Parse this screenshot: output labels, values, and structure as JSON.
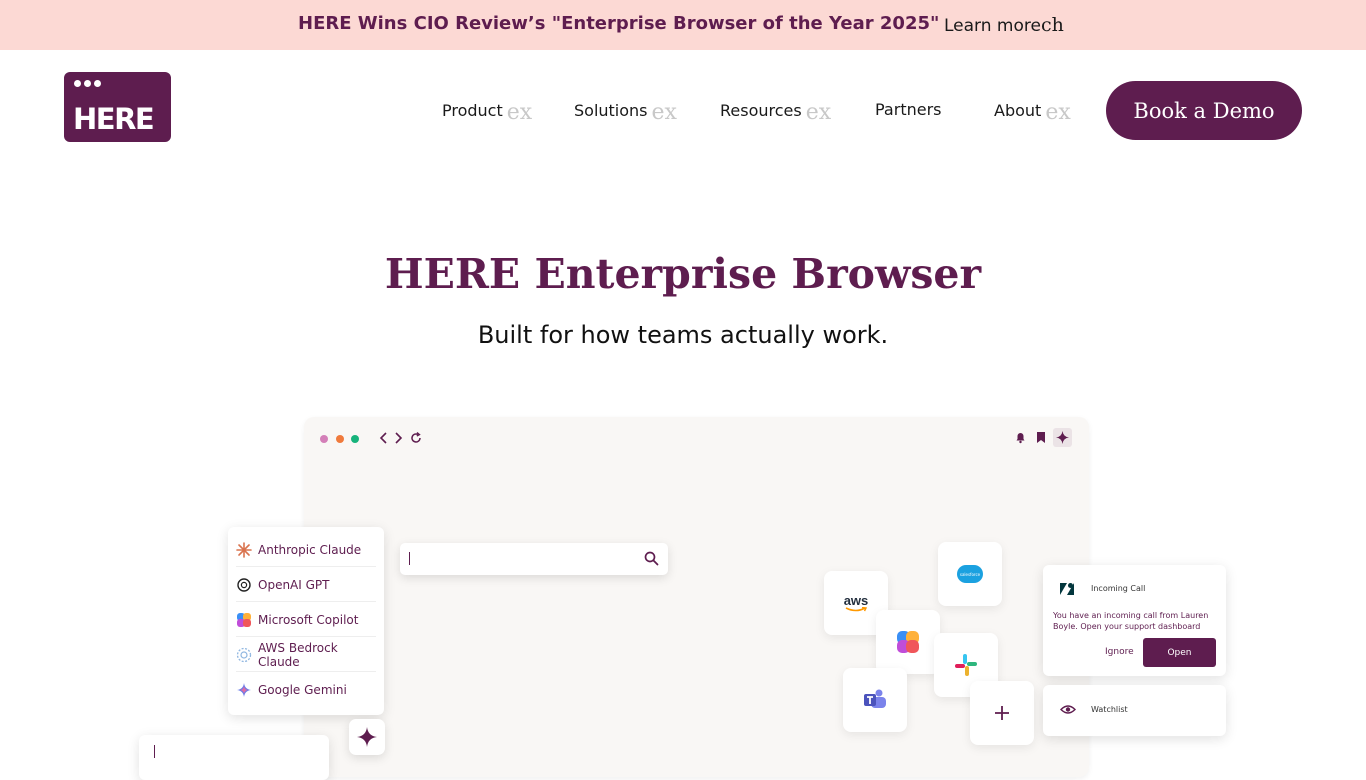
{
  "banner": {
    "text": "HERE Wins CIO Review’s \"Enterprise Browser of the Year 2025\"",
    "link_label": "Learn more",
    "link_glyph": "ch"
  },
  "header": {
    "logo_text": "HERE",
    "nav": [
      {
        "label": "Product",
        "glyph": "ex"
      },
      {
        "label": "Solutions",
        "glyph": "ex"
      },
      {
        "label": "Resources",
        "glyph": "ex"
      },
      {
        "label": "Partners"
      },
      {
        "label": "About",
        "glyph": "ex"
      }
    ],
    "cta_label": "Book a Demo"
  },
  "hero": {
    "title": "HERE Enterprise Browser",
    "subtitle": "Built for how teams actually work."
  },
  "mockup": {
    "ai_models": [
      {
        "label": "Anthropic Claude",
        "icon": "claude-icon"
      },
      {
        "label": "OpenAI GPT",
        "icon": "openai-icon"
      },
      {
        "label": "Microsoft Copilot",
        "icon": "copilot-icon"
      },
      {
        "label": "AWS Bedrock Claude",
        "icon": "bedrock-icon"
      },
      {
        "label": "Google Gemini",
        "icon": "gemini-icon"
      }
    ],
    "apps": [
      {
        "label": "aws",
        "icon": "aws-icon"
      },
      {
        "label": "salesforce",
        "icon": "salesforce-icon"
      },
      {
        "icon": "copilot-icon"
      },
      {
        "icon": "slack-icon"
      },
      {
        "icon": "teams-icon"
      },
      {
        "icon": "plus-icon"
      }
    ],
    "notification": {
      "title": "Incoming Call",
      "body": "You have an incoming call from Lauren Boyle. Open your support dashboard",
      "ignore_label": "Ignore",
      "open_label": "Open"
    },
    "watchlist_label": "Watchlist",
    "colors": {
      "brand": "#5e1d4f",
      "banner_bg": "#fcd9d4",
      "traffic_lights": [
        "#d47fb8",
        "#f07a3c",
        "#17b37b"
      ]
    }
  }
}
